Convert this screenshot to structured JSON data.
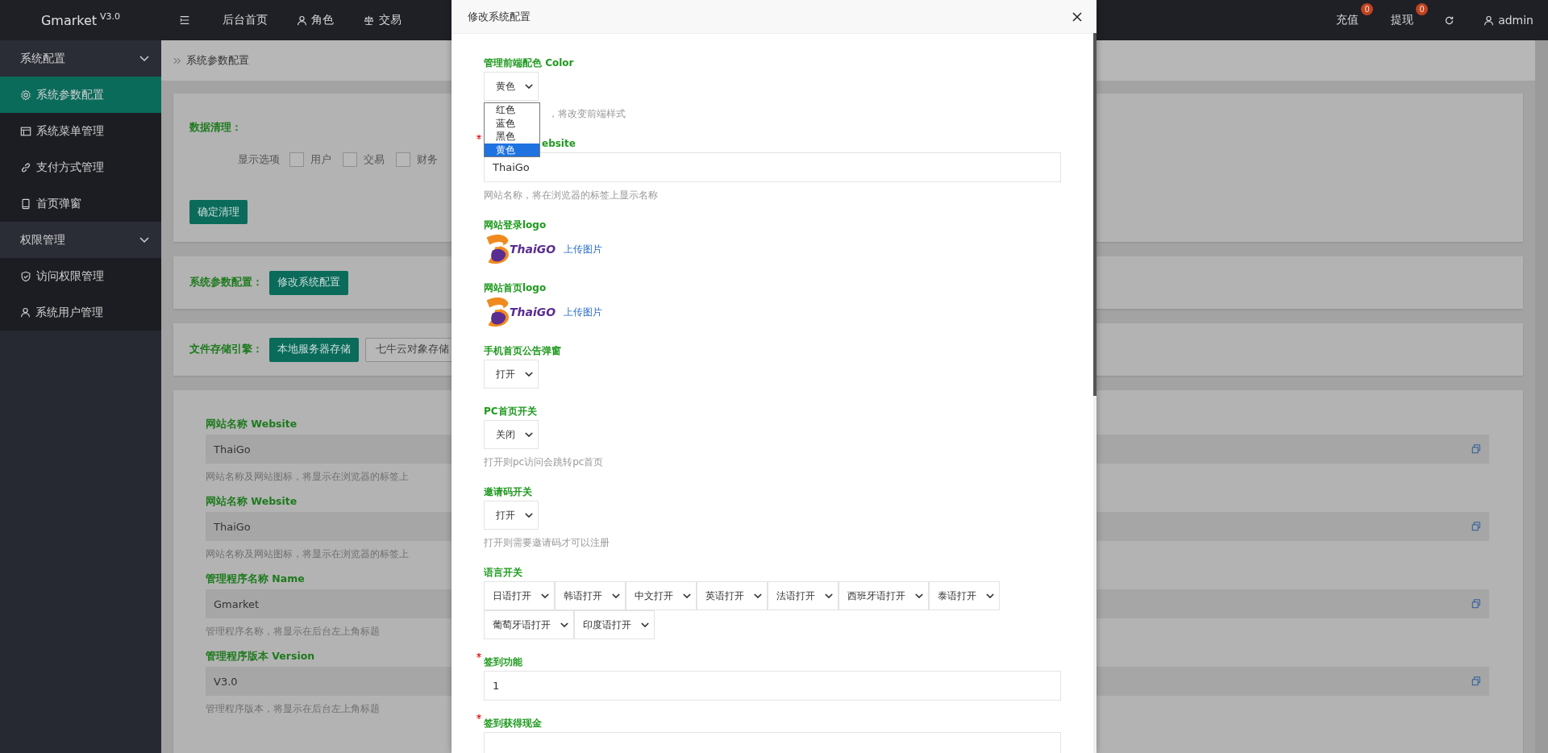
{
  "topbar": {
    "brand": "Gmarket",
    "version": "V3.0",
    "nav": [
      {
        "label": "后台首页"
      },
      {
        "label": "角色"
      },
      {
        "label": "交易"
      }
    ],
    "actions": [
      {
        "label": "充值",
        "badge": "0"
      },
      {
        "label": "提现",
        "badge": "0"
      }
    ],
    "user": "admin"
  },
  "sidebar": {
    "groups": [
      {
        "label": "系统配置",
        "expanded": true,
        "items": [
          {
            "label": "系统参数配置",
            "selected": true
          },
          {
            "label": "系统菜单管理",
            "selected": false
          },
          {
            "label": "支付方式管理",
            "selected": false
          },
          {
            "label": "首页弹窗",
            "selected": false
          }
        ]
      },
      {
        "label": "权限管理",
        "expanded": true,
        "items": [
          {
            "label": "访问权限管理",
            "selected": false
          },
          {
            "label": "系统用户管理",
            "selected": false
          }
        ]
      }
    ]
  },
  "breadcrumb": "系统参数配置",
  "cleanup": {
    "title": "数据清理：",
    "options_label": "显示选项",
    "options": [
      {
        "label": "用户",
        "checked": false
      },
      {
        "label": "交易",
        "checked": false
      },
      {
        "label": "财务",
        "checked": false
      }
    ],
    "button": "确定清理"
  },
  "params": {
    "title": "系统参数配置：",
    "button": "修改系统配置"
  },
  "storage": {
    "title": "文件存储引擎：",
    "engines": [
      {
        "label": "本地服务器存储",
        "selected": true
      },
      {
        "label": "七牛云对象存储",
        "selected": false
      }
    ]
  },
  "settings": [
    {
      "label": "网站名称 Website",
      "value": "ThaiGo",
      "hint": "网站名称及网站图标，将显示在浏览器的标签上"
    },
    {
      "label": "网站名称 Website",
      "value": "ThaiGo",
      "hint": "网站名称及网站图标，将显示在浏览器的标签上"
    },
    {
      "label": "管理程序名称 Name",
      "value": "Gmarket",
      "hint": "管理程序名称，将显示在后台左上角标题"
    },
    {
      "label": "管理程序版本 Version",
      "value": "V3.0",
      "hint": "管理程序版本，将显示在后台左上角标题"
    }
  ],
  "dialog": {
    "title": "修改系统配置",
    "fields": [
      {
        "kind": "select",
        "label": "管理前端配色 Color",
        "required": false,
        "value": "黄色",
        "hint": "，将改变前端样式",
        "open": true,
        "options": [
          {
            "label": "红色",
            "selected": false
          },
          {
            "label": "蓝色",
            "selected": false
          },
          {
            "label": "黑色",
            "selected": false
          },
          {
            "label": "黄色",
            "selected": true
          }
        ]
      },
      {
        "kind": "text",
        "label": "ebsite",
        "required": true,
        "value": "ThaiGo",
        "hint": "网站名称，将在浏览器的标签上显示名称"
      },
      {
        "kind": "image",
        "label": "网站登录logo",
        "required": false,
        "logo_text": "ThaiGO",
        "link": "上传图片"
      },
      {
        "kind": "image",
        "label": "网站首页logo",
        "required": false,
        "logo_text": "ThaiGO",
        "link": "上传图片"
      },
      {
        "kind": "select",
        "label": "手机首页公告弹窗",
        "required": false,
        "value": "打开"
      },
      {
        "kind": "select",
        "label": "PC首页开关",
        "required": false,
        "value": "关闭",
        "hint": "打开则pc访问会跳转pc首页"
      },
      {
        "kind": "select",
        "label": "邀请码开关",
        "required": false,
        "value": "打开",
        "hint": "打开则需要邀请码才可以注册"
      },
      {
        "kind": "select_group",
        "label": "语言开关",
        "required": false,
        "values": [
          "日语打开",
          "韩语打开",
          "中文打开",
          "英语打开",
          "法语打开",
          "西班牙语打开",
          "泰语打开",
          "葡萄牙语打开",
          "印度语打开"
        ]
      },
      {
        "kind": "text",
        "label": "签到功能",
        "required": true,
        "value": "1"
      },
      {
        "kind": "text",
        "label": "签到获得现金",
        "required": true
      }
    ]
  }
}
